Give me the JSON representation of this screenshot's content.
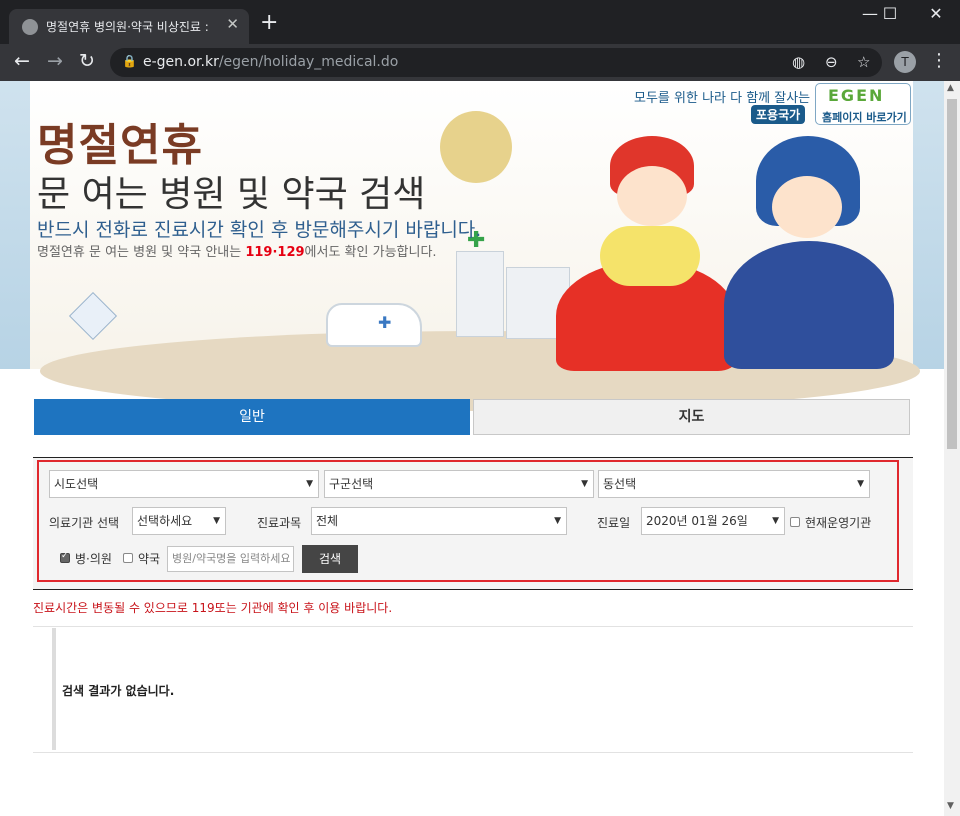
{
  "browser": {
    "tab_title": "명절연휴 병의원·약국 비상진료 :",
    "tab_close": "✕",
    "new_tab": "+",
    "window": {
      "minimize": "—",
      "maximize": "☐",
      "close": "✕"
    },
    "nav": {
      "back": "←",
      "forward": "→",
      "reload": "↻"
    },
    "url_host": "e-gen.or.kr",
    "url_path": "/egen/holiday_medical.do",
    "lock": "🔒",
    "toolbar_icons": {
      "blocked": "◍",
      "zoom": "⊖",
      "bookmark": "☆"
    },
    "avatar_initial": "T",
    "menu": "⋮"
  },
  "banner": {
    "title_line1": "명절연휴",
    "title_line2": "문 여는 병원 및 약국 검색",
    "subtitle": "반드시 전화로 진료시간 확인 후 방문해주시기 바랍니다.",
    "info_prefix": "명절연휴 문 여는 병원 및 약국 안내는 ",
    "info_numbers": "119·129",
    "info_suffix": "에서도 확인 가능합니다.",
    "slogan": "모두를 위한 나라 다 함께 잘사는",
    "slogan_badge": "포용국가",
    "home_logo": "EGEN",
    "home_link": "홈페이지 바로가기"
  },
  "tabs": {
    "general": "일반",
    "map": "지도"
  },
  "search": {
    "sido": "시도선택",
    "sigungu": "구군선택",
    "dong": "동선택",
    "institution_label": "의료기관 선택",
    "institution_value": "선택하세요",
    "department_label": "진료과목",
    "department_value": "전체",
    "date_label": "진료일",
    "date_value": "2020년 01월 26일",
    "open_now_label": "현재운영기관",
    "open_now_checked": false,
    "hospital_label": "병·의원",
    "hospital_checked": true,
    "pharmacy_label": "약국",
    "pharmacy_checked": false,
    "keyword_placeholder": "병원/약국명을 입력하세요",
    "search_button": "검색",
    "dropdown_arrow": "▼"
  },
  "notice": "진료시간은 변동될 수 있으므로 119또는 기관에 확인 후 이용 바랍니다.",
  "results": {
    "empty_message": "검색 결과가 없습니다."
  },
  "colors": {
    "accent_blue": "#1e74c0",
    "alert_red": "#c8131a",
    "box_border": "#e0282e"
  }
}
